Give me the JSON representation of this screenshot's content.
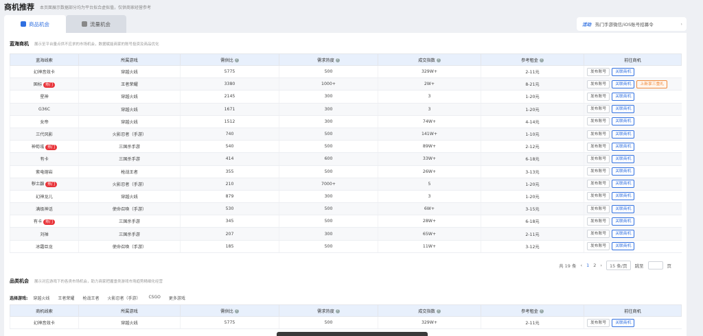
{
  "header": {
    "title": "商机推荐",
    "desc": "本页面展示数据部分均为平台拟合虚拟值，仅供商家经营参考"
  },
  "tabs": [
    {
      "label": "商品机会",
      "active": true,
      "icon": "goods-icon"
    },
    {
      "label": "流量机会",
      "active": false,
      "icon": "traffic-icon"
    }
  ],
  "notice": {
    "tag": "活动",
    "text": "热门手游微信/iOS账号招募令",
    "arrow": "›"
  },
  "section1": {
    "title": "蓝海商机",
    "desc": "展示至平台量点供不应求的市场机会，数据赋能商家的账号投资及商品优化",
    "headers": [
      "蓝海线索",
      "所属游戏",
      "需供比",
      "需求热度",
      "成交指数",
      "参考租金",
      "前往商机"
    ],
    "q_mark": "?",
    "hot_label": "热门",
    "btn_publish": "发布账号",
    "btn_link": "关联商机",
    "btn_gift": "上新享三重礼",
    "rows": [
      {
        "name": "幻神音效卡",
        "hot": false,
        "game": "穿越火线",
        "ratio": "5775",
        "heat": "500",
        "deal": "329W+",
        "rent": "2-11元",
        "gift": false
      },
      {
        "name": "国标",
        "hot": true,
        "game": "王者荣耀",
        "ratio": "3380",
        "heat": "1000+",
        "deal": "2W+",
        "rent": "8-21元",
        "gift": true
      },
      {
        "name": "星神",
        "hot": false,
        "game": "穿越火线",
        "ratio": "2145",
        "heat": "300",
        "deal": "3",
        "rent": "1-20元",
        "gift": false
      },
      {
        "name": "G36C",
        "hot": false,
        "game": "穿越火线",
        "ratio": "1671",
        "heat": "300",
        "deal": "3",
        "rent": "1-20元",
        "gift": false
      },
      {
        "name": "女帝",
        "hot": false,
        "game": "穿越火线",
        "ratio": "1512",
        "heat": "300",
        "deal": "74W+",
        "rent": "4-14元",
        "gift": false
      },
      {
        "name": "三代风影",
        "hot": false,
        "game": "火影忍者（手游）",
        "ratio": "740",
        "heat": "500",
        "deal": "141W+",
        "rent": "1-10元",
        "gift": false
      },
      {
        "name": "神荀彧",
        "hot": true,
        "game": "三国杀手游",
        "ratio": "540",
        "heat": "500",
        "deal": "89W+",
        "rent": "2-12元",
        "gift": false
      },
      {
        "name": "有卡",
        "hot": false,
        "game": "三国杀手游",
        "ratio": "414",
        "heat": "600",
        "deal": "33W+",
        "rent": "6-18元",
        "gift": false
      },
      {
        "name": "紫电熔岩",
        "hot": false,
        "game": "枪战王者",
        "ratio": "355",
        "heat": "500",
        "deal": "26W+",
        "rent": "3-13元",
        "gift": false
      },
      {
        "name": "秽土鼬",
        "hot": true,
        "game": "火影忍者（手游）",
        "ratio": "210",
        "heat": "7000+",
        "deal": "5",
        "rent": "1-20元",
        "gift": false
      },
      {
        "name": "幻神龙儿",
        "hot": false,
        "game": "穿越火线",
        "ratio": "879",
        "heat": "300",
        "deal": "3",
        "rent": "1-20元",
        "gift": false
      },
      {
        "name": "满级神话",
        "hot": false,
        "game": "使命召唤（手游）",
        "ratio": "530",
        "heat": "500",
        "deal": "6W+",
        "rent": "3-15元",
        "gift": false
      },
      {
        "name": "有卡",
        "hot": true,
        "game": "三国杀手游",
        "ratio": "345",
        "heat": "500",
        "deal": "28W+",
        "rent": "6-18元",
        "gift": false
      },
      {
        "name": "刘禅",
        "hot": false,
        "game": "三国杀手游",
        "ratio": "207",
        "heat": "300",
        "deal": "65W+",
        "rent": "2-11元",
        "gift": false
      },
      {
        "name": "冰霜巨龙",
        "hot": false,
        "game": "使命召唤（手游）",
        "ratio": "185",
        "heat": "500",
        "deal": "11W+",
        "rent": "3-12元",
        "gift": false
      }
    ]
  },
  "pager": {
    "total": "共 19 条",
    "prev": "‹",
    "pages": [
      "1",
      "2"
    ],
    "next": "›",
    "size": "15 条/页",
    "jump": "跳至",
    "unit": "页"
  },
  "section2": {
    "title": "品类机会",
    "desc": "展示对应游戏下的各类市场机会，助力商家把握垂类游戏市场趋势精细化经营",
    "filter_label": "选择游戏:",
    "filters": [
      "穿越火线",
      "王者荣耀",
      "枪战王者",
      "火影忍者（手游）",
      "CSGO",
      "更多游戏"
    ],
    "headers": [
      "商机线索",
      "所属游戏",
      "需供比",
      "需求热度",
      "成交指数",
      "参考租金",
      "前往商机"
    ],
    "rows": [
      {
        "name": "幻神音效卡",
        "game": "穿越火线",
        "ratio": "5775",
        "heat": "500",
        "deal": "329W+",
        "rent": "2-11元"
      }
    ]
  },
  "colors": {
    "accent": "#2f6fe0",
    "hot": "#e8343a",
    "gift": "#f08a3c",
    "header_bg": "#e8f0fc"
  }
}
